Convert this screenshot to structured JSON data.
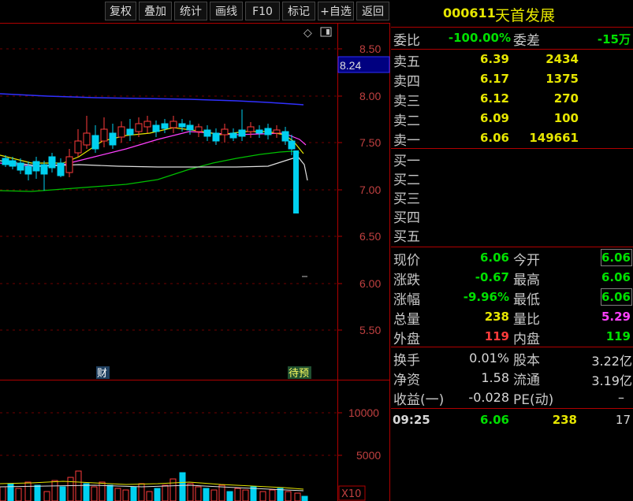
{
  "toolbar": {
    "items": [
      "复权",
      "叠加",
      "统计",
      "画线",
      "F10",
      "标记",
      "+自选",
      "返回"
    ]
  },
  "chart": {
    "price_axis": [
      "8.50",
      "8.00",
      "7.50",
      "7.00",
      "6.50",
      "6.00",
      "5.50"
    ],
    "current_price_tag": "8.24",
    "volume_axis": [
      "10000",
      "5000"
    ],
    "volume_unit": "X10",
    "marker_cai": "财",
    "marker_daiyu": "待预",
    "diamond_icon": "◇"
  },
  "stock": {
    "code": "000611",
    "name": "天首发展"
  },
  "commission": {
    "ratio_label": "委比",
    "ratio_value": "-100.00%",
    "diff_label": "委差",
    "diff_value": "-15万"
  },
  "sell_orders": [
    {
      "label": "卖五",
      "price": "6.39",
      "volume": "2434"
    },
    {
      "label": "卖四",
      "price": "6.17",
      "volume": "1375"
    },
    {
      "label": "卖三",
      "price": "6.12",
      "volume": "270"
    },
    {
      "label": "卖二",
      "price": "6.09",
      "volume": "100"
    },
    {
      "label": "卖一",
      "price": "6.06",
      "volume": "149661"
    }
  ],
  "buy_orders": [
    {
      "label": "买一"
    },
    {
      "label": "买二"
    },
    {
      "label": "买三"
    },
    {
      "label": "买四"
    },
    {
      "label": "买五"
    }
  ],
  "quote": {
    "current_label": "现价",
    "current_value": "6.06",
    "open_label": "今开",
    "open_value": "6.06",
    "change_label": "涨跌",
    "change_value": "-0.67",
    "high_label": "最高",
    "high_value": "6.06",
    "pct_label": "涨幅",
    "pct_value": "-9.96%",
    "low_label": "最低",
    "low_value": "6.06",
    "volume_label": "总量",
    "volume_value": "238",
    "volratio_label": "量比",
    "volratio_value": "5.29",
    "outer_label": "外盘",
    "outer_value": "119",
    "inner_label": "内盘",
    "inner_value": "119"
  },
  "fundamentals": {
    "turnover_label": "换手",
    "turnover_value": "0.01%",
    "equity_label": "股本",
    "equity_value": "3.22亿",
    "netasset_label": "净资",
    "netasset_value": "1.58",
    "float_label": "流通",
    "float_value": "3.19亿",
    "eps_label": "收益(一)",
    "eps_value": "-0.028",
    "pe_label": "PE(动)",
    "pe_value": "–"
  },
  "tick": {
    "time": "09:25",
    "price": "6.06",
    "volume": "238",
    "count": "17"
  },
  "colors": {
    "up": "#ff3b3b",
    "down": "#00d0f0",
    "grid": "#b00000",
    "ma_white": "#e0e0e0",
    "ma_yellow": "#e6e600",
    "ma_magenta": "#ff40ff",
    "ma_green": "#00c000",
    "ma_blue": "#3030ff"
  }
}
